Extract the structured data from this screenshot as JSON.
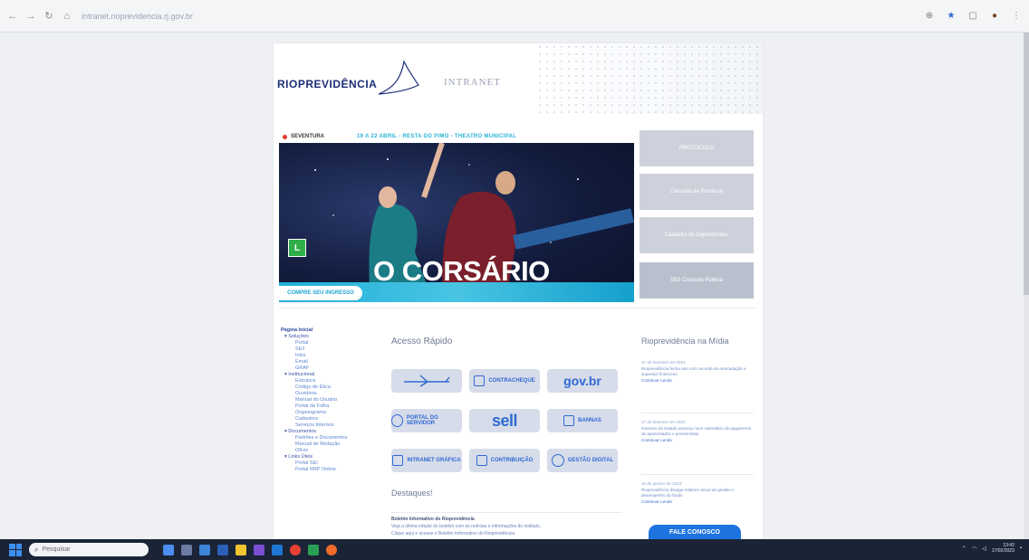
{
  "browser": {
    "url": "intranet.rioprevidencia.rj.gov.br"
  },
  "header": {
    "logo_text": "RIOPREVIDÊNCIA",
    "section_label": "INTRANET"
  },
  "banner": {
    "brand": "SEVENTURA",
    "date_line": "19 A 22 ABRIL - RESTA DO PIMO - THEATRO MUNICIPAL",
    "title": "O CORSÁRIO",
    "rating": "L",
    "cta": "COMPRE SEU INGRESSO"
  },
  "left_nav": {
    "head": "Página Inicial",
    "sections": [
      {
        "label": "▾ Soluções",
        "items": [
          "Portal",
          "SEI!",
          "Intra",
          "Email",
          "GRAF"
        ]
      },
      {
        "label": "▾ Institucional",
        "items": [
          "Estrutura",
          "Código de Ética",
          "Ouvidoria",
          "Manual do Usuário",
          "Portal da Folha",
          "Organograma",
          "Cadastros",
          "Serviços Internos"
        ]
      },
      {
        "label": "▾ Documentos",
        "items": [
          "Padrões e Documentos",
          "Manual de Redação",
          "Ofício"
        ]
      },
      {
        "label": "▾ Links Úteis",
        "items": [
          "Portal SEI",
          "Portal RRP Online"
        ]
      }
    ]
  },
  "quick_access": {
    "title": "Acesso Rápido",
    "tiles": [
      "",
      "CONTRACHEQUE",
      "gov.br",
      "PORTAL DO SERVIDOR",
      "sell",
      "BANNAS",
      "INTRANET GRÁFICA",
      "CONTRIBUIÇÃO",
      "GESTÃO DIGITAL"
    ]
  },
  "destaques": {
    "title": "Destaques!",
    "headline": "Boletim Informativo do Rioprevidência",
    "line2": "Veja a última edição do boletim com as notícias e informações do instituto.",
    "line3": "Clique aqui e acesse o Boletim Informativo do Rioprevidência"
  },
  "side_buttons": [
    "PROTOCOLO",
    "Consulta de Processo",
    "Cadastro de Dependentes",
    "SEI! Consulta Pública"
  ],
  "news": {
    "title": "Rioprevidência na Mídia",
    "items": [
      {
        "date": "17 de fevereiro de 2023",
        "text": "Rioprevidência fecha ano com recorde de arrecadação e superávit financeiro",
        "more": "Continuar Lendo"
      },
      {
        "date": "17 de fevereiro de 2023",
        "text": "Governo do Estado anuncia novo calendário de pagamento de aposentados e pensionistas",
        "more": "Continuar Lendo"
      },
      {
        "date": "10 de janeiro de 2023",
        "text": "Rioprevidência divulga relatório anual de gestão e desempenho do fundo",
        "more": "Continuar Lendo"
      }
    ]
  },
  "fab": {
    "label": "FALE CONOSCO"
  },
  "taskbar": {
    "search_placeholder": "Pesquisar",
    "time": "13:42",
    "date": "17/02/2023"
  }
}
